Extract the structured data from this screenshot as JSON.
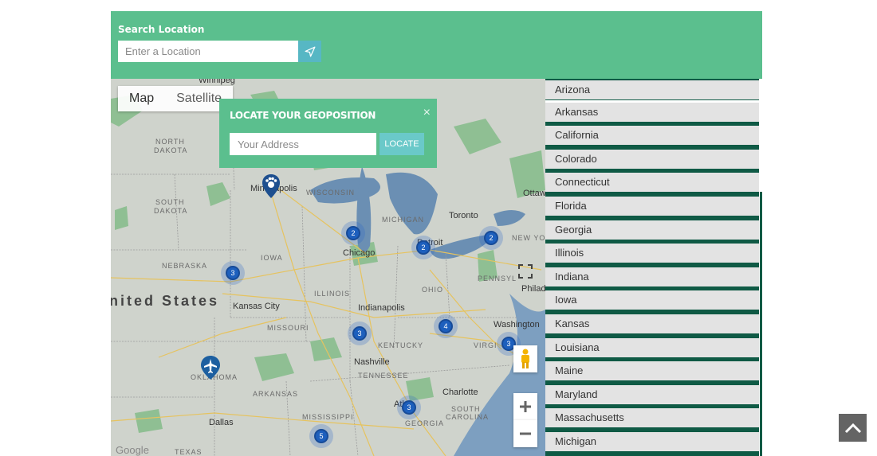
{
  "search": {
    "title": "Search Location",
    "placeholder": "Enter a Location",
    "value": ""
  },
  "map": {
    "type_buttons": [
      "Map",
      "Satellite"
    ],
    "active_type": "Map",
    "labels": {
      "winnipeg": "Winnipeg",
      "north_dakota_1": "NORTH",
      "north_dakota_2": "DAKOTA",
      "south_dakota_1": "SOUTH",
      "south_dakota_2": "DAKOTA",
      "minneapolis": "Minneapolis",
      "wisconsin": "WISCONSIN",
      "michigan": "MICHIGAN",
      "toronto": "Toronto",
      "ottawa": "Ottaw",
      "new_york": "NEW YOR",
      "nebraska": "NEBRASKA",
      "iowa": "IOWA",
      "chicago": "Chicago",
      "detroit": "Detroit",
      "united_states": "nited States",
      "kansas_city": "Kansas City",
      "illinois": "ILLINOIS",
      "indianapolis": "Indianapolis",
      "ohio": "OHIO",
      "pennsylvania": "PENNSYL",
      "philadelphia": "Philad",
      "missouri": "MISSOURI",
      "kentucky": "KENTUCKY",
      "washington": "Washington",
      "virginia": "VIRGI",
      "oklahoma": "OKLAHOMA",
      "nashville": "Nashville",
      "tennessee": "TENNESSEE",
      "arkansas": "ARKANSAS",
      "charlotte": "Charlotte",
      "south_carolina_1": "SOUTH",
      "south_carolina_2": "CAROLINA",
      "dallas": "Dallas",
      "mississippi": "MISSISSIPPI",
      "atlanta": "Atla",
      "georgia": "GEORGIA",
      "texas": "TEXAS",
      "google": "Google"
    },
    "clusters": [
      "2",
      "2",
      "2",
      "3",
      "3",
      "4",
      "3",
      "3",
      "5"
    ]
  },
  "popup": {
    "title": "LOCATE YOUR GEOPOSITION",
    "close": "×",
    "placeholder": "Your Address",
    "button": "LOCATE"
  },
  "states": [
    "Arizona",
    "Arkansas",
    "California",
    "Colorado",
    "Connecticut",
    "Florida",
    "Georgia",
    "Illinois",
    "Indiana",
    "Iowa",
    "Kansas",
    "Louisiana",
    "Maine",
    "Maryland",
    "Massachusetts",
    "Michigan"
  ],
  "colors": {
    "header_green": "#5bbf8e",
    "state_border": "#0f5a45",
    "state_bg": "#e3e3e3",
    "locate_button": "#6ac9c9",
    "search_button": "#57b7c4"
  }
}
